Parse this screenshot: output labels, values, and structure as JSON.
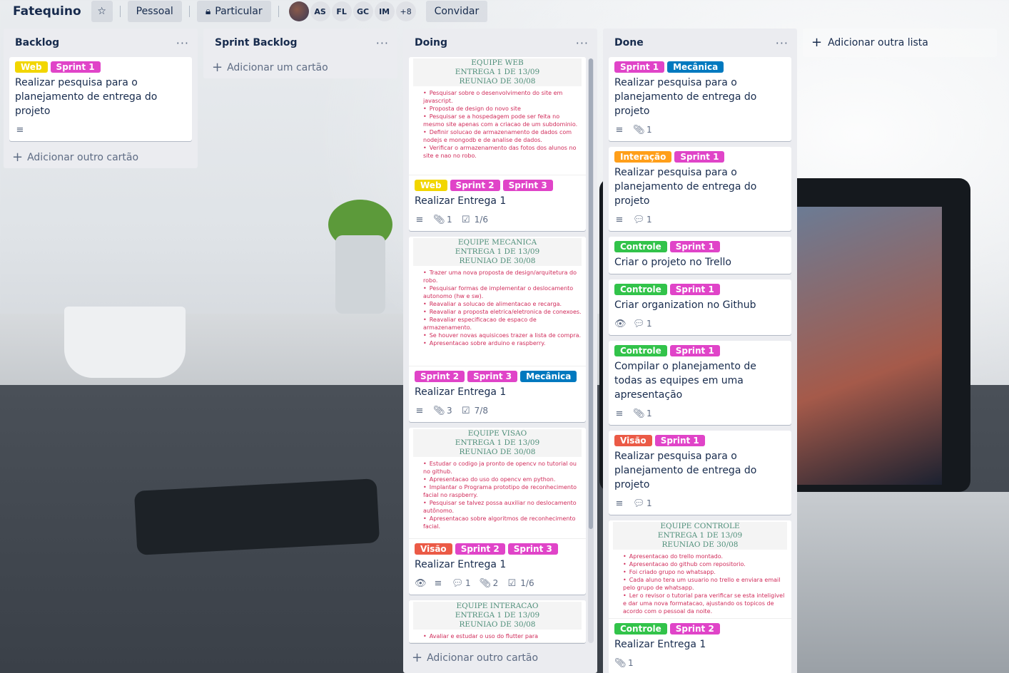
{
  "header": {
    "board_title": "Fatequino",
    "star_icon": "star-icon",
    "team_label": "Pessoal",
    "visibility_label": "Particular",
    "members": [
      "AS",
      "FL",
      "GC",
      "IM"
    ],
    "more_members": "+8",
    "invite_label": "Convidar"
  },
  "colors": {
    "yellow": "#f2d600",
    "magenta": "#e044c8",
    "blue": "#0079bf",
    "green": "#32c34a",
    "orange": "#ff9f1a",
    "red": "#eb5a46"
  },
  "lists": [
    {
      "title": "Backlog",
      "cards": [
        {
          "labels": [
            {
              "text": "Web",
              "color": "#f2d600"
            },
            {
              "text": "Sprint 1",
              "color": "#e044c8"
            }
          ],
          "title": "Realizar pesquisa para o planejamento de entrega do projeto",
          "badges": [
            {
              "icon": "description-icon",
              "value": ""
            }
          ]
        }
      ],
      "add_label": "Adicionar outro cartão"
    },
    {
      "title": "Sprint Backlog",
      "cards": [],
      "add_label": "Adicionar um cartão"
    },
    {
      "title": "Doing",
      "cards": [
        {
          "cover": {
            "head": [
              "EQUIPE WEB",
              "ENTREGA 1 DE 13/09",
              "REUNIAO DE 30/08"
            ],
            "lines": [
              "Pesquisar sobre o desenvolvimento do site em javascript.",
              "Proposta de design do novo site",
              "Pesquisar se a hospedagem pode ser feita no mesmo site apenas com a criacao de um subdominio.",
              "Definir solucao de armazenamento de dados com nodejs e mongodb e de analise de dados.",
              "Verificar o armazenamento das fotos dos alunos no site e nao no robo."
            ]
          },
          "labels": [
            {
              "text": "Web",
              "color": "#f2d600"
            },
            {
              "text": "Sprint 2",
              "color": "#e044c8"
            },
            {
              "text": "Sprint 3",
              "color": "#e044c8"
            }
          ],
          "title": "Realizar Entrega 1",
          "badges": [
            {
              "icon": "description-icon",
              "value": ""
            },
            {
              "icon": "attachment-icon",
              "value": "1"
            },
            {
              "icon": "checklist-icon",
              "value": "1/6"
            }
          ]
        },
        {
          "cover": {
            "head": [
              "EQUIPE MECANICA",
              "ENTREGA 1 DE 13/09",
              "REUNIAO DE 30/08"
            ],
            "lines": [
              "Trazer uma nova proposta de design/arquitetura do robo.",
              "Pesquisar formas de implementar o deslocamento autonomo (hw e sw).",
              "Reavaliar a solucao de alimentacao e recarga.",
              "Reavaliar a proposta eletrica/eletronica de conexoes.",
              "Reavaliar especificacao de espaco de armazenamento.",
              "Se houver novas aquisicoes trazer a lista de compra.",
              "Apresentacao sobre arduino e raspberry."
            ]
          },
          "labels": [
            {
              "text": "Sprint 2",
              "color": "#e044c8"
            },
            {
              "text": "Sprint 3",
              "color": "#e044c8"
            },
            {
              "text": "Mecânica",
              "color": "#0079bf"
            }
          ],
          "title": "Realizar Entrega 1",
          "badges": [
            {
              "icon": "description-icon",
              "value": ""
            },
            {
              "icon": "attachment-icon",
              "value": "3"
            },
            {
              "icon": "checklist-icon",
              "value": "7/8"
            }
          ]
        },
        {
          "cover": {
            "head": [
              "EQUIPE VISAO",
              "ENTREGA 1 DE 13/09",
              "REUNIAO DE 30/08"
            ],
            "lines": [
              "Estudar o codigo ja pronto de opencv no tutorial ou no github.",
              "Apresentacao do uso do opencv em python.",
              "Implantar o Programa prototipo de reconhecimento facial no raspberry.",
              "Pesquisar se talvez possa auxiliar no deslocamento autônomo.",
              "Apresentacao sobre algoritmos de reconhecimento facial."
            ]
          },
          "labels": [
            {
              "text": "Visão",
              "color": "#eb5a46"
            },
            {
              "text": "Sprint 2",
              "color": "#e044c8"
            },
            {
              "text": "Sprint 3",
              "color": "#e044c8"
            }
          ],
          "title": "Realizar Entrega 1",
          "badges": [
            {
              "icon": "watch-icon",
              "value": ""
            },
            {
              "icon": "description-icon",
              "value": ""
            },
            {
              "icon": "comment-icon",
              "value": "1"
            },
            {
              "icon": "attachment-icon",
              "value": "2"
            },
            {
              "icon": "checklist-icon",
              "value": "1/6"
            }
          ]
        },
        {
          "cover": {
            "head": [
              "EQUIPE INTERACAO",
              "ENTREGA 1 DE 13/09",
              "REUNIAO DE 30/08"
            ],
            "lines": [
              "Avaliar e estudar o uso do flutter para"
            ]
          },
          "labels": [],
          "title": "",
          "badges": []
        }
      ],
      "add_label": "Adicionar outro cartão"
    },
    {
      "title": "Done",
      "cards": [
        {
          "labels": [
            {
              "text": "Sprint 1",
              "color": "#e044c8"
            },
            {
              "text": "Mecânica",
              "color": "#0079bf"
            }
          ],
          "title": "Realizar pesquisa para o planejamento de entrega do projeto",
          "badges": [
            {
              "icon": "description-icon",
              "value": ""
            },
            {
              "icon": "attachment-icon",
              "value": "1"
            }
          ]
        },
        {
          "labels": [
            {
              "text": "Interação",
              "color": "#ff9f1a"
            },
            {
              "text": "Sprint 1",
              "color": "#e044c8"
            }
          ],
          "title": "Realizar pesquisa para o planejamento de entrega do projeto",
          "badges": [
            {
              "icon": "description-icon",
              "value": ""
            },
            {
              "icon": "comment-icon",
              "value": "1"
            }
          ]
        },
        {
          "labels": [
            {
              "text": "Controle",
              "color": "#32c34a"
            },
            {
              "text": "Sprint 1",
              "color": "#e044c8"
            }
          ],
          "title": "Criar o projeto no Trello",
          "badges": []
        },
        {
          "labels": [
            {
              "text": "Controle",
              "color": "#32c34a"
            },
            {
              "text": "Sprint 1",
              "color": "#e044c8"
            }
          ],
          "title": "Criar organization no Github",
          "badges": [
            {
              "icon": "watch-icon",
              "value": ""
            },
            {
              "icon": "comment-icon",
              "value": "1"
            }
          ]
        },
        {
          "labels": [
            {
              "text": "Controle",
              "color": "#32c34a"
            },
            {
              "text": "Sprint 1",
              "color": "#e044c8"
            }
          ],
          "title": "Compilar o planejamento de todas as equipes em uma apresentação",
          "badges": [
            {
              "icon": "description-icon",
              "value": ""
            },
            {
              "icon": "attachment-icon",
              "value": "1"
            }
          ]
        },
        {
          "labels": [
            {
              "text": "Visão",
              "color": "#eb5a46"
            },
            {
              "text": "Sprint 1",
              "color": "#e044c8"
            }
          ],
          "title": "Realizar pesquisa para o planejamento de entrega do projeto",
          "badges": [
            {
              "icon": "description-icon",
              "value": ""
            },
            {
              "icon": "comment-icon",
              "value": "1"
            }
          ]
        },
        {
          "cover": {
            "head": [
              "EQUIPE CONTROLE",
              "ENTREGA 1 DE 13/09",
              "REUNIAO DE 30/08"
            ],
            "lines": [
              "Apresentacao do trello montado.",
              "Apresentacao do github com repositorio.",
              "Foi criado grupo no whatsapp.",
              "Cada aluno tera um usuario no trello e enviara email pelo grupo de whatsapp.",
              "Ler o revisor o tutorial para verificar se esta inteligivel e dar uma nova formatacao, ajustando os topicos de acordo com o pessoal da noite."
            ]
          },
          "labels": [
            {
              "text": "Controle",
              "color": "#32c34a"
            },
            {
              "text": "Sprint 2",
              "color": "#e044c8"
            }
          ],
          "title": "Realizar Entrega 1",
          "badges": [
            {
              "icon": "attachment-icon",
              "value": "1"
            }
          ]
        }
      ],
      "add_label": "Adicionar outro cartão"
    }
  ],
  "add_list_label": "Adicionar outra lista"
}
